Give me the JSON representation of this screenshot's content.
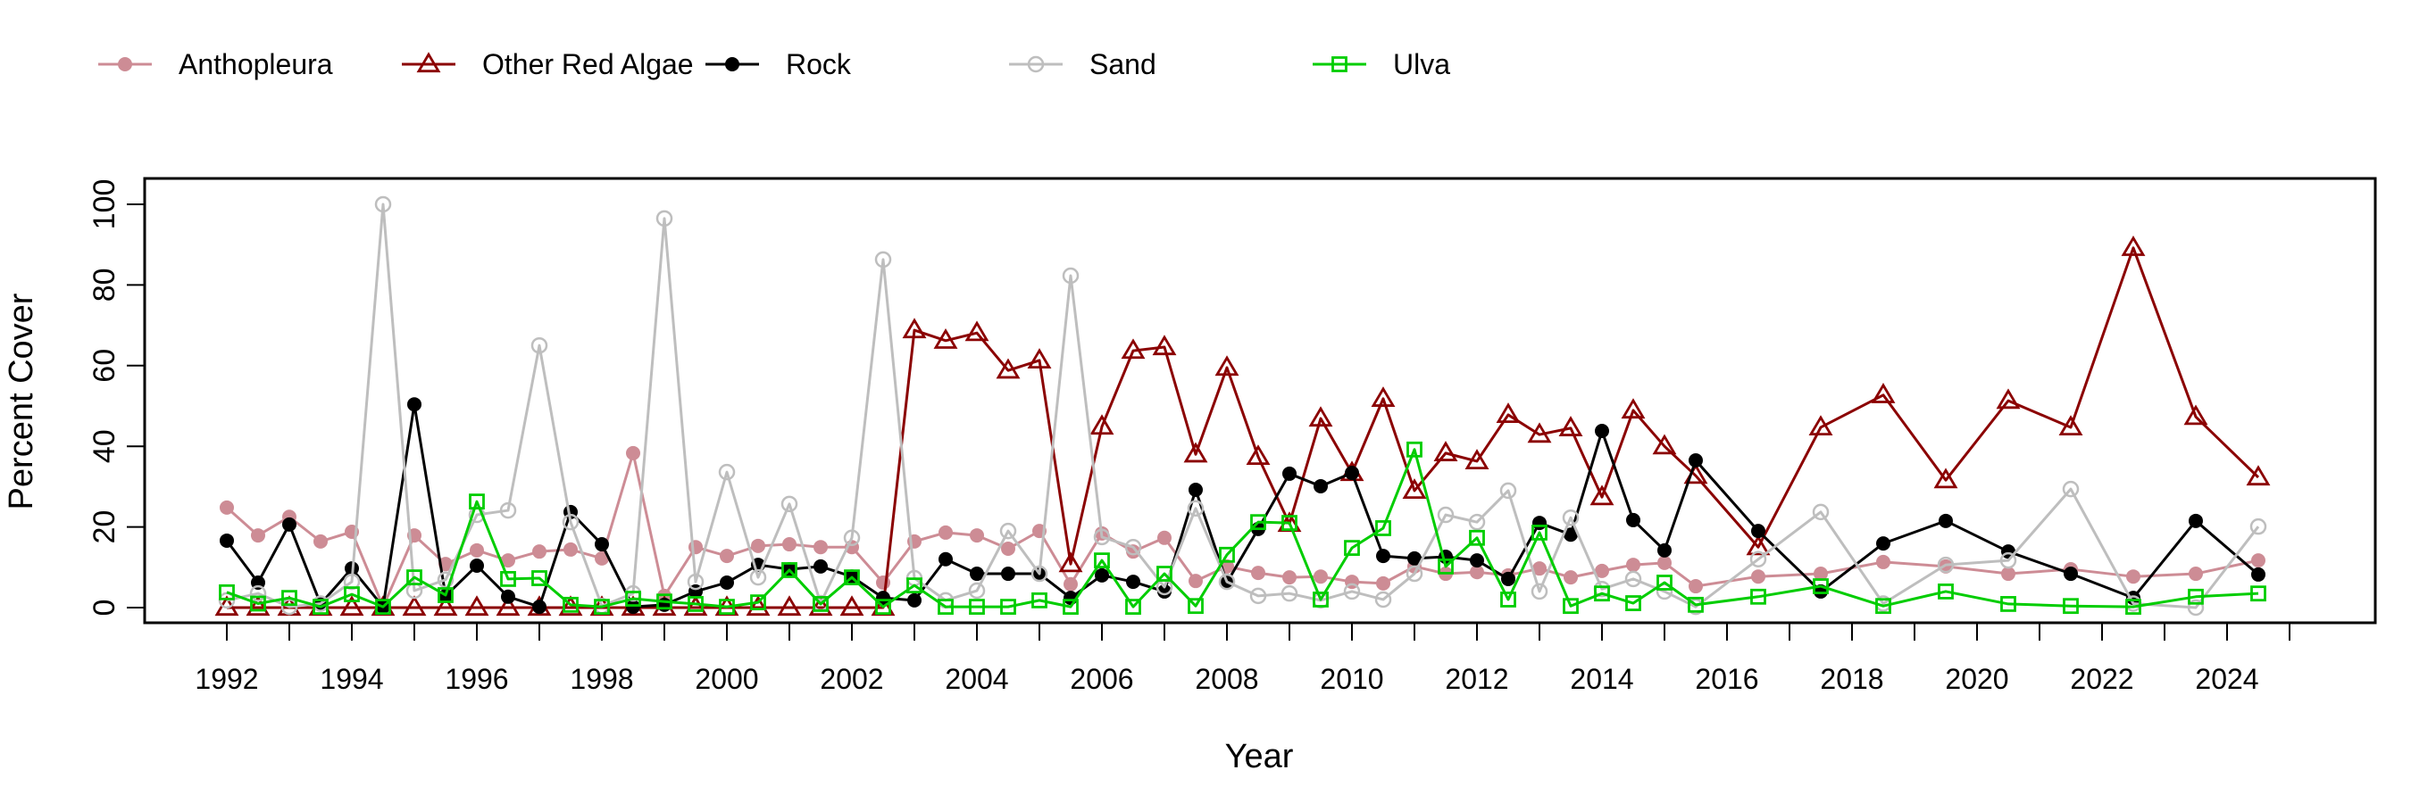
{
  "chart_data": {
    "type": "line",
    "title": "",
    "xlabel": "Year",
    "ylabel": "Percent Cover",
    "xlim": [
      1990.4,
      2026.2
    ],
    "ylim": [
      0,
      100
    ],
    "x_ticks": [
      1992,
      1993,
      1994,
      1995,
      1996,
      1997,
      1998,
      1999,
      2000,
      2001,
      2002,
      2003,
      2004,
      2005,
      2006,
      2007,
      2008,
      2009,
      2010,
      2011,
      2012,
      2013,
      2014,
      2015,
      2016,
      2017,
      2018,
      2019,
      2020,
      2021,
      2022,
      2023,
      2024,
      2025
    ],
    "x_tick_labels": [
      "1992",
      "",
      "1994",
      "",
      "1996",
      "",
      "1998",
      "",
      "2000",
      "",
      "2002",
      "",
      "2004",
      "",
      "2006",
      "",
      "2008",
      "",
      "2010",
      "",
      "2012",
      "",
      "2014",
      "",
      "2016",
      "",
      "2018",
      "",
      "2020",
      "",
      "2022",
      "",
      "2024",
      ""
    ],
    "y_ticks": [
      0,
      20,
      40,
      60,
      80,
      100
    ],
    "y_tick_labels": [
      "0",
      "20",
      "40",
      "60",
      "80",
      "100"
    ],
    "grid": false,
    "legend_placement": "top",
    "x": [
      1992,
      1992.5,
      1993,
      1993.5,
      1994,
      1994.5,
      1995,
      1995.5,
      1996,
      1996.5,
      1997,
      1997.5,
      1998,
      1998.5,
      1999,
      1999.5,
      2000,
      2000.5,
      2001,
      2001.5,
      2002,
      2002.5,
      2003,
      2003.5,
      2004,
      2004.5,
      2005,
      2005.5,
      2006,
      2006.5,
      2007,
      2007.5,
      2008,
      2008.5,
      2009,
      2009.5,
      2010,
      2010.5,
      2011,
      2011.5,
      2012,
      2012.5,
      2013,
      2013.5,
      2014,
      2014.5,
      2015,
      2015.5,
      2016.5,
      2017.5,
      2018.5,
      2019.5,
      2020.5,
      2021.5,
      2022.5,
      2023.5,
      2024.5
    ],
    "series": [
      {
        "name": "Anthopleura",
        "color": "#CD8C95",
        "marker": "filled-circle",
        "values": [
          24.8,
          17.9,
          22.5,
          16.4,
          18.8,
          0.2,
          17.9,
          10.8,
          14.2,
          11.7,
          13.9,
          14.4,
          12.2,
          38.3,
          2.9,
          15.0,
          12.8,
          15.3,
          15.7,
          15.0,
          15.0,
          6.2,
          16.4,
          18.6,
          17.9,
          14.6,
          19.0,
          5.8,
          18.4,
          13.9,
          17.3,
          6.6,
          10.2,
          8.6,
          7.5,
          7.7,
          6.4,
          6.0,
          10.2,
          8.4,
          8.8,
          8.0,
          9.7,
          7.5,
          9.1,
          10.6,
          11.1,
          5.3,
          7.7,
          8.4,
          11.3,
          10.2,
          8.4,
          9.5,
          7.7,
          8.4,
          11.7
        ]
      },
      {
        "name": "Other Red Algae",
        "color": "#8B0000",
        "marker": "open-triangle",
        "values": [
          0,
          0,
          0,
          0,
          0,
          0,
          0,
          0,
          0,
          0,
          0,
          0,
          0,
          0,
          0,
          0,
          0,
          0,
          0,
          0,
          0,
          0,
          68.8,
          66.2,
          68.1,
          58.8,
          61.3,
          10.8,
          44.9,
          63.7,
          64.6,
          38.0,
          59.5,
          37.4,
          20.8,
          46.9,
          33.4,
          51.8,
          29.0,
          38.3,
          36.3,
          47.8,
          42.9,
          44.5,
          27.4,
          48.9,
          40.0,
          32.7,
          15.0,
          44.7,
          52.7,
          31.6,
          51.3,
          44.7,
          89.2,
          47.3,
          32.3
        ]
      },
      {
        "name": "Rock",
        "color": "#000000",
        "marker": "filled-circle",
        "values": [
          16.6,
          6.2,
          20.6,
          0.9,
          9.7,
          0.2,
          50.4,
          2.9,
          10.4,
          2.7,
          0.2,
          23.7,
          15.7,
          0.2,
          0.7,
          4.0,
          6.2,
          10.6,
          9.5,
          10.2,
          7.7,
          2.4,
          1.8,
          12.0,
          8.4,
          8.4,
          8.4,
          2.4,
          8.0,
          6.4,
          4.0,
          29.2,
          6.2,
          19.5,
          33.2,
          30.1,
          33.4,
          12.8,
          12.2,
          12.6,
          11.7,
          7.1,
          21.0,
          18.1,
          43.8,
          21.7,
          14.2,
          36.5,
          19.0,
          4.0,
          15.9,
          21.5,
          13.9,
          8.4,
          2.4,
          21.5,
          8.2
        ]
      },
      {
        "name": "Sand",
        "color": "#BEBEBE",
        "marker": "open-circle",
        "values": [
          1.8,
          3.5,
          0.2,
          1.0,
          6.4,
          100,
          4.2,
          6.9,
          23.0,
          24.1,
          65.0,
          21.2,
          0.4,
          3.5,
          96.5,
          6.4,
          33.6,
          7.5,
          25.7,
          1.1,
          17.3,
          86.3,
          7.3,
          1.8,
          4.2,
          19.0,
          8.4,
          82.3,
          17.5,
          15.0,
          5.1,
          24.6,
          6.4,
          2.9,
          3.5,
          1.8,
          4.0,
          2.0,
          8.4,
          23.0,
          21.2,
          29.0,
          4.0,
          22.3,
          4.6,
          7.1,
          4.0,
          0.2,
          12.0,
          23.7,
          1.0,
          10.6,
          11.7,
          29.4,
          1.0,
          0.0,
          20.1
        ]
      },
      {
        "name": "Ulva",
        "color": "#00CD00",
        "marker": "open-square",
        "values": [
          3.8,
          1.0,
          2.4,
          0.2,
          3.3,
          0.2,
          7.5,
          3.1,
          26.3,
          7.1,
          7.3,
          0.7,
          0.2,
          2.2,
          1.5,
          0.9,
          0.2,
          1.3,
          9.3,
          0.9,
          7.5,
          0.2,
          5.5,
          0.2,
          0.2,
          0.2,
          1.8,
          0.2,
          11.7,
          0.2,
          8.4,
          0.4,
          13.1,
          21.2,
          21.0,
          2.0,
          14.8,
          19.7,
          39.2,
          10.2,
          17.3,
          2.0,
          18.6,
          0.4,
          3.5,
          1.1,
          6.2,
          0.7,
          2.7,
          5.3,
          0.4,
          4.0,
          0.9,
          0.4,
          0.2,
          2.7,
          3.5
        ]
      }
    ]
  }
}
